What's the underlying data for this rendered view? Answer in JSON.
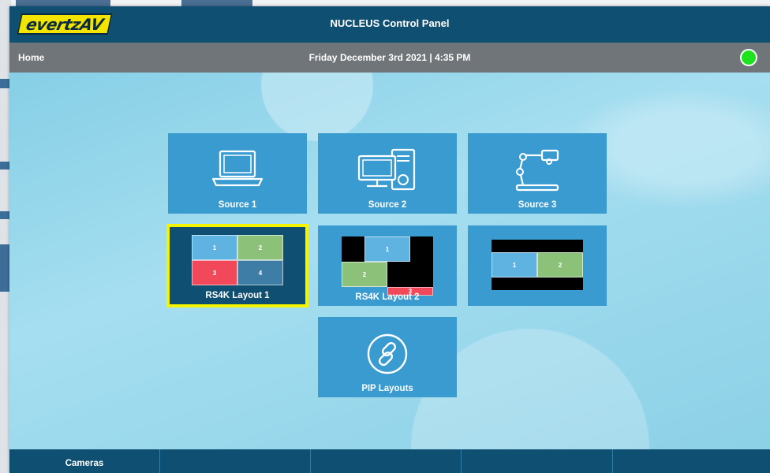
{
  "app": {
    "logo_text": "evertzAV",
    "title": "NUCLEUS Control Panel"
  },
  "status": {
    "home_label": "Home",
    "datetime": "Friday December 3rd 2021 | 4:35 PM",
    "indicator_color": "#1ee21e"
  },
  "tiles": {
    "source1": {
      "label": "Source 1",
      "icon": "laptop-icon"
    },
    "source2": {
      "label": "Source 2",
      "icon": "desktop-computer-icon"
    },
    "source3": {
      "label": "Source 3",
      "icon": "document-camera-icon"
    },
    "layout1": {
      "label": "RS4K Layout 1",
      "cells": [
        "1",
        "2",
        "3",
        "4"
      ],
      "selected": true
    },
    "layout2": {
      "label": "RS4K Layout 2",
      "cells": [
        "1",
        "2",
        "3"
      ]
    },
    "layout3": {
      "label": "",
      "cells": [
        "1",
        "2"
      ]
    },
    "pip": {
      "label": "PIP Layouts",
      "icon": "link-icon"
    }
  },
  "bottom_nav": {
    "items": [
      "Cameras",
      "",
      "",
      "",
      ""
    ]
  },
  "colors": {
    "header": "#0f4f72",
    "tile": "#3a9bd1",
    "selected_border": "#f4f300",
    "blue_cell": "#5fb3e0",
    "green_cell": "#8cc17a",
    "red_cell": "#f1485a",
    "steel_cell": "#3e7ea6"
  }
}
